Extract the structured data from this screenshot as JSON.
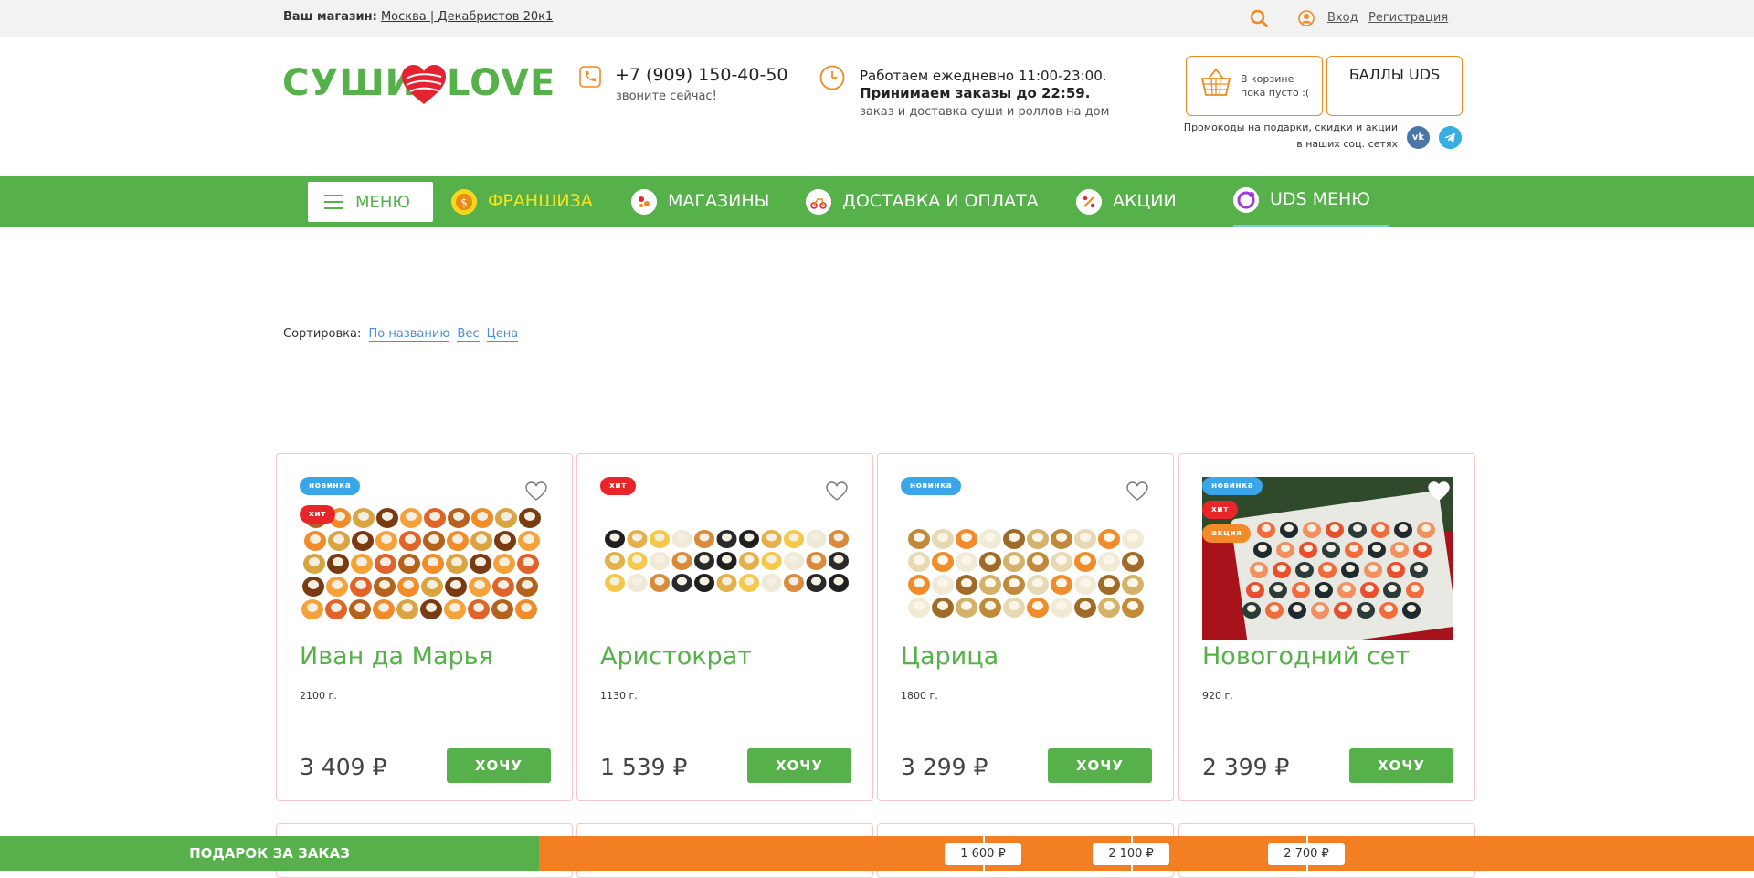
{
  "topbar": {
    "store_label": "Ваш магазин:",
    "store_value": "Москва | Декабристов 20к1",
    "login": "Вход",
    "register": "Регистрация"
  },
  "header": {
    "logo_left": "СУШИ",
    "logo_right": "LOVE",
    "phone": "+7 (909) 150-40-50",
    "phone_sub": "звоните сейчас!",
    "hours_line1": "Работаем ежедневно 11:00-23:00.",
    "hours_line2": "Принимаем заказы до 22:59.",
    "hours_line3": "заказ и доставка суши и роллов на дом",
    "cart_line1": "В корзине",
    "cart_line2": "пока пусто :(",
    "uds_button": "БАЛЛЫ UDS",
    "promo_line1": "Промокоды на подарки, скидки и акции",
    "promo_line2": "в наших соц. сетях",
    "vk_label": "vk"
  },
  "nav": {
    "menu": "МЕНЮ",
    "franchise": "ФРАНШИЗА",
    "stores": "МАГАЗИНЫ",
    "delivery": "ДОСТАВКА И ОПЛАТА",
    "promos": "АКЦИИ",
    "uds_menu": "UDS МЕНЮ"
  },
  "sort": {
    "label": "Сортировка:",
    "by_name": "По названию",
    "by_weight": "Вес",
    "by_price": "Цена"
  },
  "products": [
    {
      "name": "Иван да Марья",
      "weight": "2100 г.",
      "price": "3 409 ₽",
      "buy": "ХОЧУ",
      "badges": [
        "новинка",
        "хит"
      ]
    },
    {
      "name": "Аристократ",
      "weight": "1130 г.",
      "price": "1 539 ₽",
      "buy": "ХОЧУ",
      "badges": [
        "хит"
      ]
    },
    {
      "name": "Царица",
      "weight": "1800 г.",
      "price": "3 299 ₽",
      "buy": "ХОЧУ",
      "badges": [
        "новинка"
      ]
    },
    {
      "name": "Новогодний сет",
      "weight": "920 г.",
      "price": "2 399 ₽",
      "buy": "ХОЧУ",
      "badges": [
        "новинка",
        "хит",
        "акция"
      ]
    }
  ],
  "giftbar": {
    "label": "ПОДАРОК ЗА ЗАКАЗ",
    "thresholds": [
      "1 600 ₽",
      "2 100 ₽",
      "2 700 ₽"
    ]
  },
  "colors": {
    "brand_green": "#56b14a",
    "accent_orange": "#f37f22",
    "badge_new": "#3aa6e8",
    "badge_hit": "#e8262a",
    "badge_sale": "#f48b2a"
  }
}
